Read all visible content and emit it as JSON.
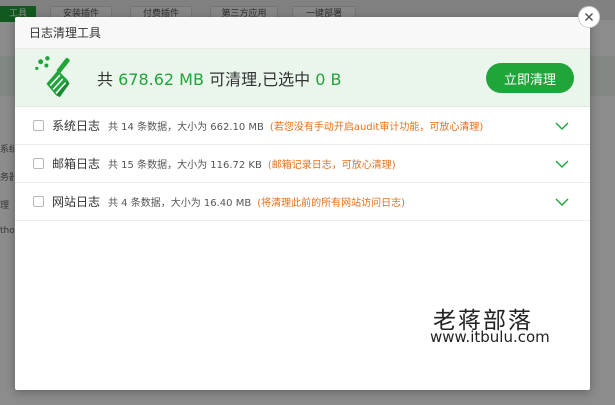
{
  "background": {
    "tabs": [
      "工具",
      "安装插件",
      "付费插件",
      "第三方应用",
      "一键部署"
    ],
    "side_labels": [
      "系统",
      "务器",
      "理",
      "tho"
    ]
  },
  "dialog": {
    "title": "日志清理工具",
    "summary": {
      "prefix": "共",
      "total": "678.62 MB",
      "middle": "可清理,已选中",
      "selected": "0 B"
    },
    "clean_button": "立即清理",
    "items": [
      {
        "name": "系统日志",
        "info": "共 14 条数据，大小为 662.10 MB",
        "note": "(若您没有手动开启audit审计功能，可放心清理)",
        "checked": false
      },
      {
        "name": "邮箱日志",
        "info": "共 15 条数据，大小为 116.72 KB",
        "note": "(邮箱记录日志，可放心清理)",
        "checked": false
      },
      {
        "name": "网站日志",
        "info": "共 4 条数据，大小为 16.40 MB",
        "note": "(将清理此前的所有网站访问日志)",
        "checked": false
      }
    ]
  },
  "watermark": {
    "name": "老蒋部落",
    "url": "www.itbulu.com"
  },
  "colors": {
    "accent": "#20a53a",
    "note": "#e8701a",
    "summary_bg": "#eaf6ec"
  },
  "icons": {
    "broom": "broom-icon",
    "close": "close-icon",
    "expand": "chevron-down-icon"
  }
}
